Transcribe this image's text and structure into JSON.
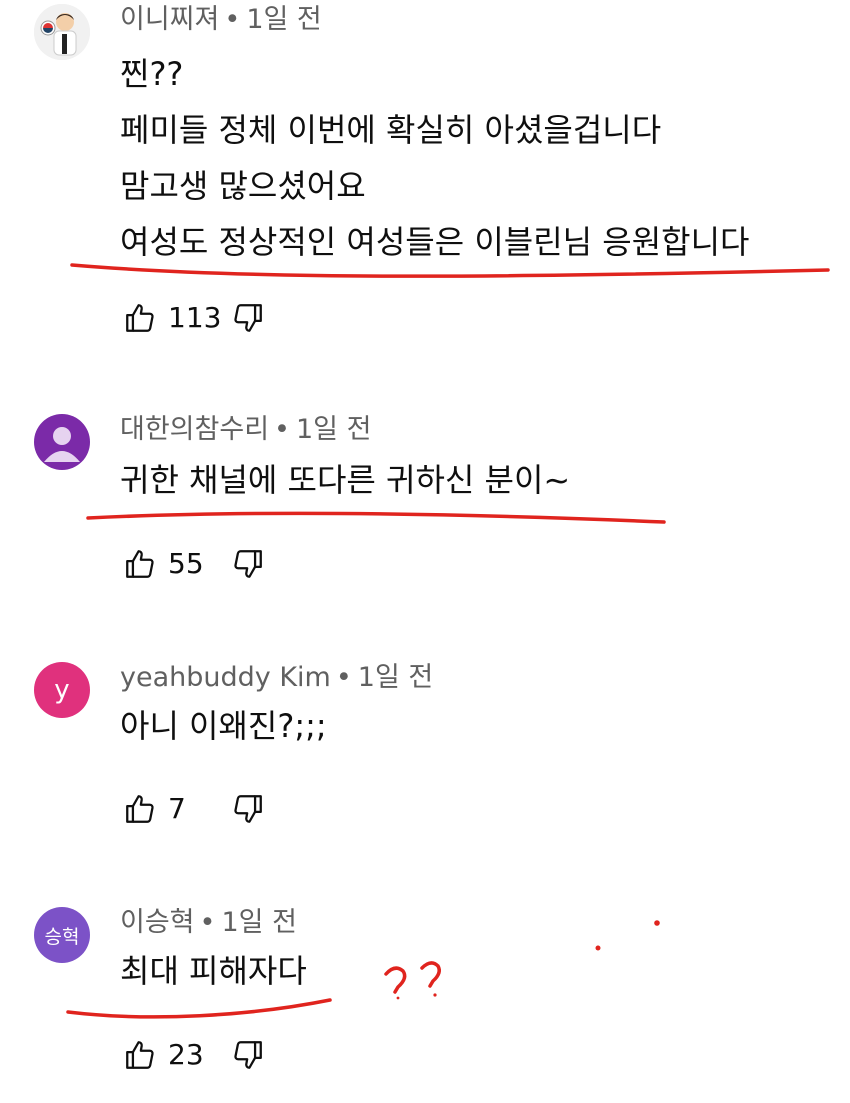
{
  "comments": [
    {
      "author": "이니찌져",
      "time": "1일 전",
      "avatar_color": "#d9d9d9",
      "avatar_text": "",
      "avatar_icon": "child-photo-icon",
      "lines": [
        "찐??",
        "페미들 정체 이번에 확실히 아셨을겁니다",
        "맘고생 많으셨어요",
        "여성도 정상적인 여성들은 이블린님 응원합니다"
      ],
      "likes": "113"
    },
    {
      "author": "대한의참수리",
      "time": "1일 전",
      "avatar_color": "#7b2aa8",
      "avatar_text": "",
      "avatar_icon": "default-person-icon",
      "lines": [
        "귀한 채널에 또다른 귀하신 분이~"
      ],
      "likes": "55"
    },
    {
      "author": "yeahbuddy Kim",
      "time": "1일 전",
      "avatar_color": "#e0317d",
      "avatar_text": "y",
      "avatar_icon": "",
      "lines": [
        "아니 이왜진?;;;"
      ],
      "likes": "7"
    },
    {
      "author": "이승혁",
      "time": "1일 전",
      "avatar_color": "#7c52c7",
      "avatar_text": "승혁",
      "avatar_icon": "",
      "lines": [
        "최대 피해자다"
      ],
      "likes": "23"
    }
  ],
  "annotation": {
    "handwritten_text": "??",
    "color": "#e0241e"
  },
  "separator": "•"
}
